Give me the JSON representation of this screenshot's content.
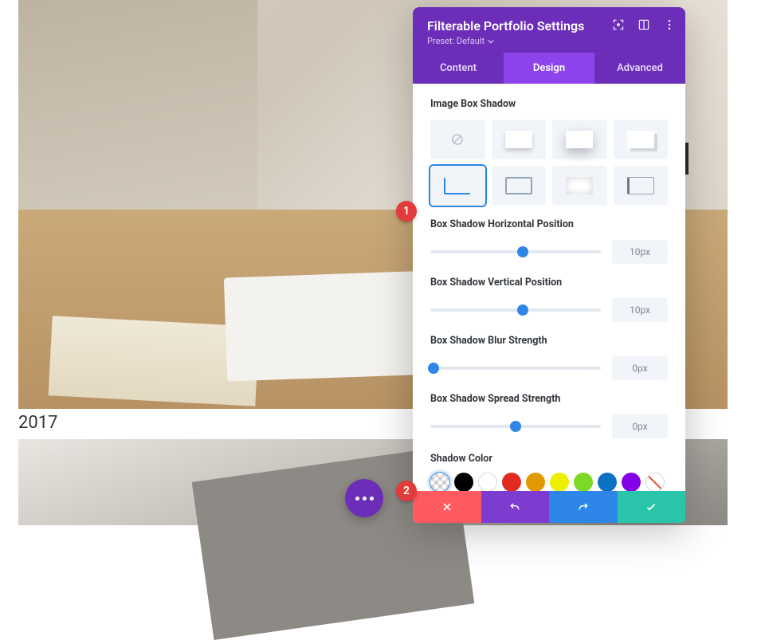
{
  "portfolio": {
    "caption": "2017"
  },
  "fab": {
    "name": "module-options"
  },
  "annotations": {
    "b1": "1",
    "b2": "2"
  },
  "panel": {
    "title": "Filterable Portfolio Settings",
    "preset_label": "Preset: Default",
    "tabs": {
      "content": "Content",
      "design": "Design",
      "advanced": "Advanced",
      "active": "design"
    },
    "section_image_shadow": "Image Box Shadow",
    "sliders": {
      "h": {
        "label": "Box Shadow Horizontal Position",
        "value": "10px",
        "pct": 54
      },
      "v": {
        "label": "Box Shadow Vertical Position",
        "value": "10px",
        "pct": 54
      },
      "blur": {
        "label": "Box Shadow Blur Strength",
        "value": "0px",
        "pct": 2
      },
      "spread": {
        "label": "Box Shadow Spread Strength",
        "value": "0px",
        "pct": 50
      }
    },
    "shadow_color_label": "Shadow Color",
    "colors": [
      "transparent",
      "#000000",
      "#ffffff",
      "#e02b20",
      "#e09900",
      "#edf000",
      "#7cda24",
      "#0c71c3",
      "#8300e9",
      "none"
    ]
  }
}
